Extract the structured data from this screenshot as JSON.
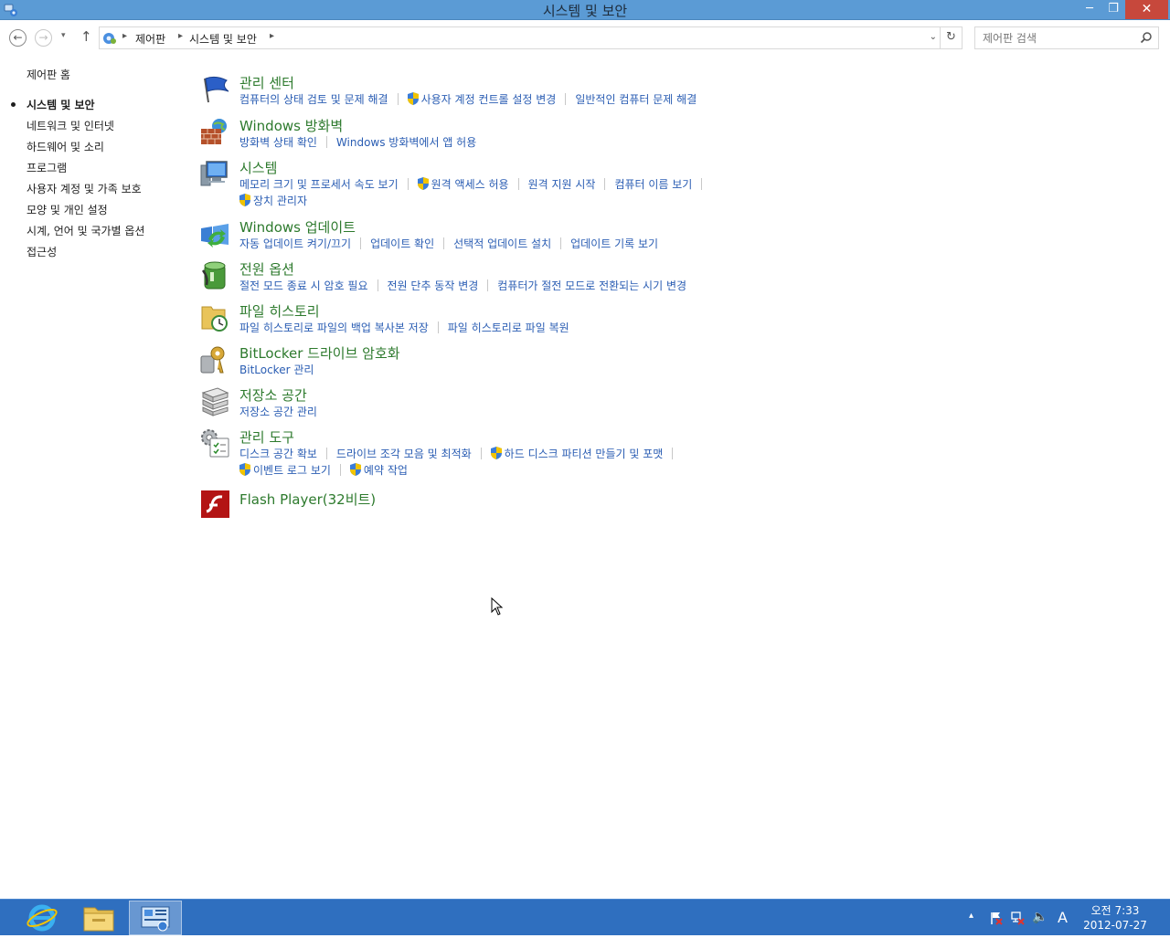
{
  "window": {
    "title": "시스템 및 보안",
    "min_glyph": "─",
    "max_glyph": "❐",
    "close_glyph": "✕"
  },
  "nav": {
    "back_glyph": "←",
    "forward_glyph": "→",
    "recent_glyph": "▾",
    "up_glyph": "↑",
    "breadcrumb": [
      "제어판",
      "시스템 및 보안"
    ],
    "breadcrumb_sep": "▸",
    "address_dropdown_glyph": "⌄",
    "refresh_glyph": "↻",
    "search_placeholder": "제어판 검색"
  },
  "sidebar": {
    "home": "제어판 홈",
    "items": [
      {
        "label": "시스템 및 보안",
        "active": true
      },
      {
        "label": "네트워크 및 인터넷",
        "active": false
      },
      {
        "label": "하드웨어 및 소리",
        "active": false
      },
      {
        "label": "프로그램",
        "active": false
      },
      {
        "label": "사용자 계정 및 가족 보호",
        "active": false
      },
      {
        "label": "모양 및 개인 설정",
        "active": false
      },
      {
        "label": "시계, 언어 및 국가별 옵션",
        "active": false
      },
      {
        "label": "접근성",
        "active": false
      }
    ]
  },
  "categories": [
    {
      "title": "관리 센터",
      "icon": "action-center-flag-icon",
      "links": [
        "컴퓨터의 상태 검토 및 문제 해결",
        "사용자 계정 컨트롤 설정 변경",
        "일반적인 컴퓨터 문제 해결"
      ]
    },
    {
      "title": "Windows 방화벽",
      "icon": "firewall-icon",
      "links": [
        "방화벽 상태 확인",
        "Windows 방화벽에서 앱 허용"
      ]
    },
    {
      "title": "시스템",
      "icon": "system-computer-icon",
      "links": [
        "메모리 크기 및 프로세서 속도 보기",
        "원격 액세스 허용",
        "원격 지원 시작",
        "컴퓨터 이름 보기",
        "장치 관리자"
      ]
    },
    {
      "title": "Windows 업데이트",
      "icon": "windows-update-icon",
      "links": [
        "자동 업데이트 켜기/끄기",
        "업데이트 확인",
        "선택적 업데이트 설치",
        "업데이트 기록 보기"
      ]
    },
    {
      "title": "전원 옵션",
      "icon": "power-options-icon",
      "links": [
        "절전 모드 종료 시 암호 필요",
        "전원 단추 동작 변경",
        "컴퓨터가 절전 모드로 전환되는 시기 변경"
      ]
    },
    {
      "title": "파일 히스토리",
      "icon": "file-history-icon",
      "links": [
        "파일 히스토리로 파일의 백업 복사본 저장",
        "파일 히스토리로 파일 복원"
      ]
    },
    {
      "title": "BitLocker 드라이브 암호화",
      "icon": "bitlocker-key-icon",
      "links": [
        "BitLocker 관리"
      ]
    },
    {
      "title": "저장소 공간",
      "icon": "storage-spaces-icon",
      "links": [
        "저장소 공간 관리"
      ]
    },
    {
      "title": "관리 도구",
      "icon": "admin-tools-icon",
      "links": [
        "디스크 공간 확보",
        "드라이브 조각 모음 및 최적화",
        "하드 디스크 파티션 만들기 및 포맷",
        "이벤트 로그 보기",
        "예약 작업"
      ]
    },
    {
      "title": "Flash Player(32비트)",
      "icon": "flash-player-icon",
      "links": []
    }
  ],
  "taskbar": {
    "pinned": [
      "internet-explorer-icon",
      "file-explorer-icon",
      "control-panel-icon"
    ],
    "tray_up_glyph": "▴",
    "volume_glyph": "🔈",
    "ime": "A",
    "clock_time": "오전 7:33",
    "clock_date": "2012-07-27"
  },
  "colors": {
    "title_bar": "#5b9bd5",
    "category_title": "#2d7a2d",
    "link": "#2a5db3",
    "taskbar": "#2f6fbf",
    "close_button": "#c7483c"
  }
}
